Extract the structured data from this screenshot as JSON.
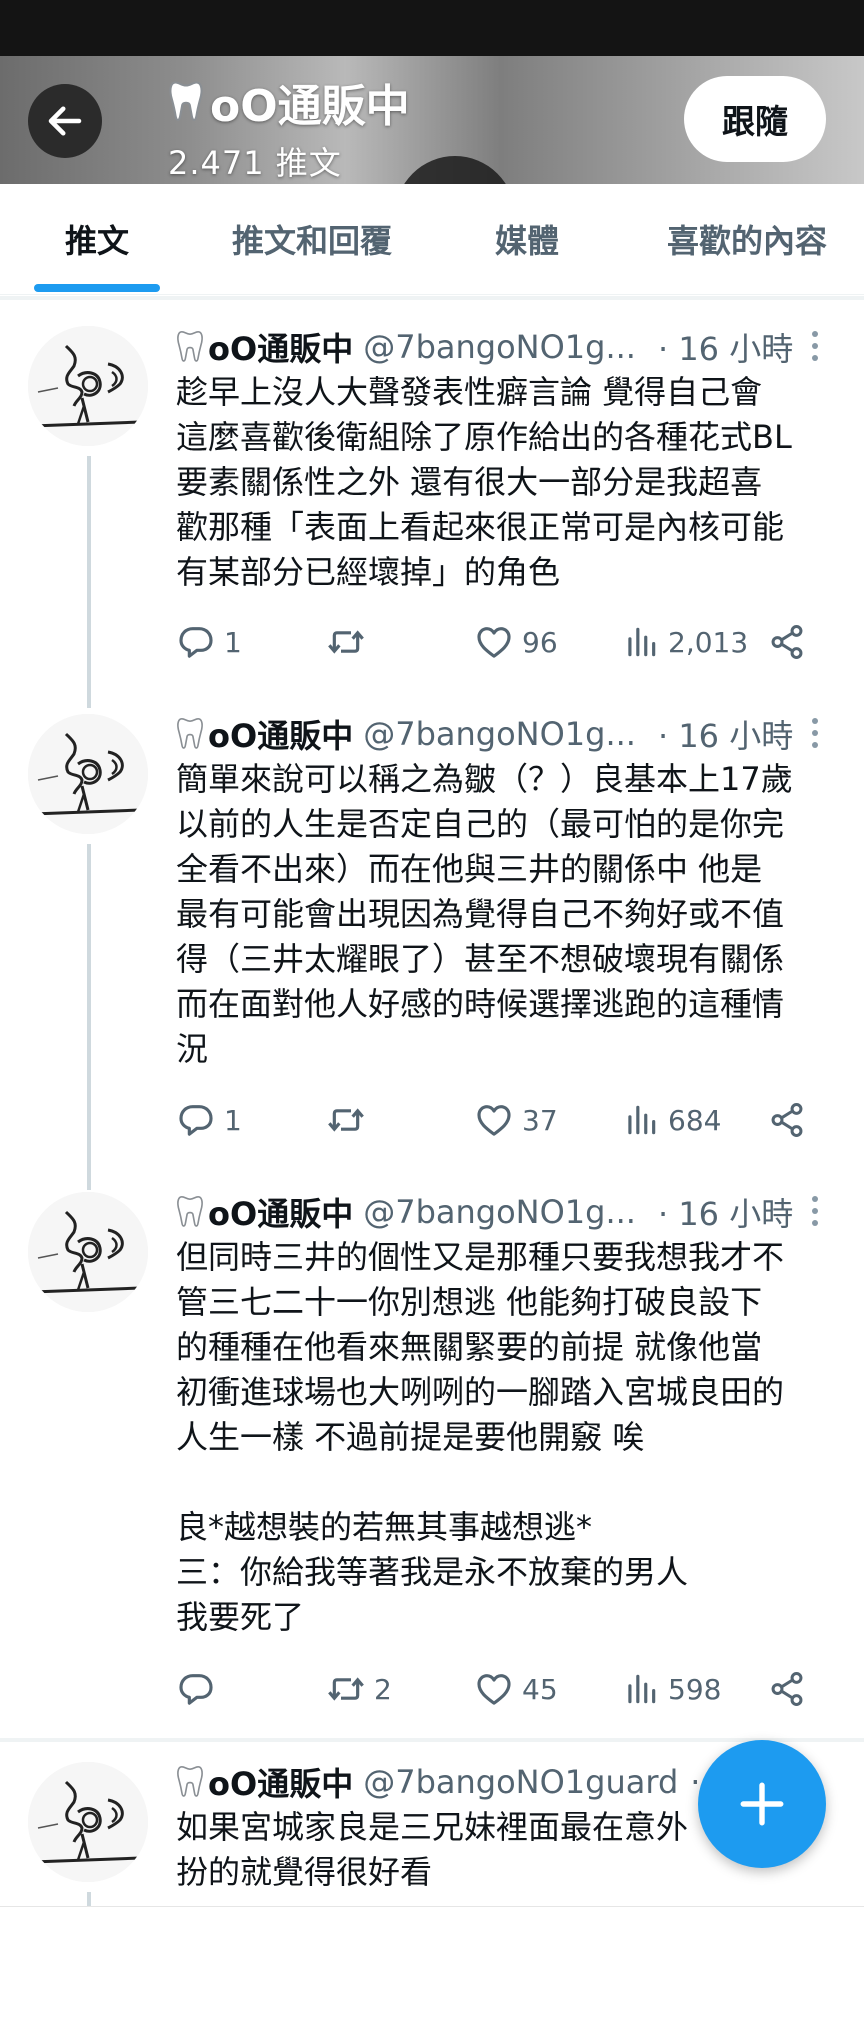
{
  "header": {
    "title": "oO通販中",
    "tweet_count": "2.471 推文",
    "follow_label": "跟隨"
  },
  "tabs": [
    {
      "label": "推文",
      "active": true
    },
    {
      "label": "推文和回覆",
      "active": false
    },
    {
      "label": "媒體",
      "active": false
    },
    {
      "label": "喜歡的內容",
      "active": false
    }
  ],
  "tweets": [
    {
      "name": "oO通販中",
      "handle": "@7bangoNO1g...",
      "time": "· 16 小時",
      "lines": [
        "趁早上沒人大聲發表性癖言論 覺得自己會",
        "這麼喜歡後衛組除了原作給出的各種花式BL",
        "要素關係性之外 還有很大一部分是我超喜",
        "歡那種「表面上看起來很正常可是內核可能",
        "有某部分已經壞掉」的角色"
      ],
      "replies": "1",
      "retweets": "",
      "likes": "96",
      "views": "2,013"
    },
    {
      "name": "oO通販中",
      "handle": "@7bangoNO1g...",
      "time": "· 16 小時",
      "lines": [
        "簡單來說可以稱之為皺（？）良基本上17歲",
        "以前的人生是否定自己的（最可怕的是你完",
        "全看不出來）而在他與三井的關係中 他是",
        "最有可能會出現因為覺得自己不夠好或不值",
        "得（三井太耀眼了）甚至不想破壞現有關係",
        "而在面對他人好感的時候選擇逃跑的這種情",
        "況"
      ],
      "replies": "1",
      "retweets": "",
      "likes": "37",
      "views": "684"
    },
    {
      "name": "oO通販中",
      "handle": "@7bangoNO1g...",
      "time": "· 16 小時",
      "lines": [
        "但同時三井的個性又是那種只要我想我才不",
        "管三七二十一你別想逃 他能夠打破良設下",
        "的種種在他看來無關緊要的前提 就像他當",
        "初衝進球場也大咧咧的一腳踏入宮城良田的",
        "人生一樣 不過前提是要他開竅 唉",
        "",
        "良*越想裝的若無其事越想逃*",
        "三：你給我等著我是永不放棄的男人",
        "我要死了"
      ],
      "replies": "",
      "retweets": "2",
      "likes": "45",
      "views": "598"
    },
    {
      "name": "oO通販中",
      "handle": "@7bangoNO1guard",
      "time": "·",
      "lines": [
        "如果宮城家良是三兄妹裡面最在意外",
        "扮的就覺得很好看"
      ]
    }
  ],
  "colors": {
    "accent": "#1d9bf0",
    "text": "#0f1419",
    "muted": "#536471"
  }
}
